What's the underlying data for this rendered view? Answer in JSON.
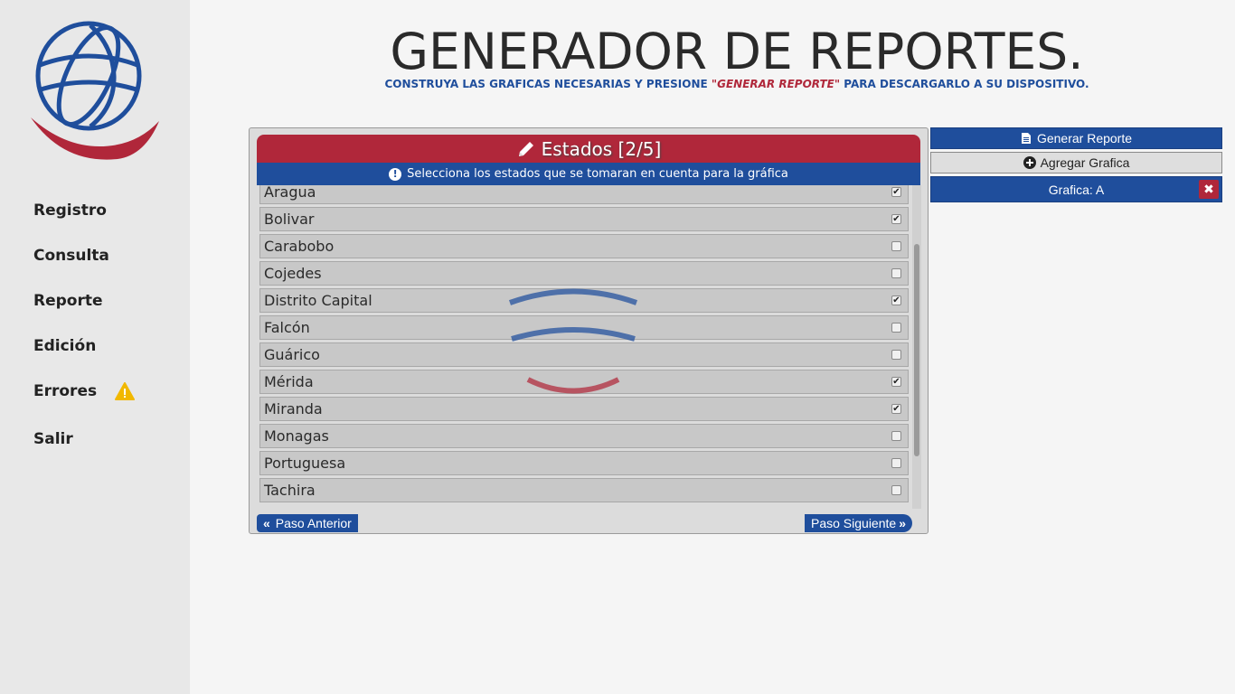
{
  "sidebar": {
    "nav": [
      {
        "label": "Registro"
      },
      {
        "label": "Consulta"
      },
      {
        "label": "Reporte"
      },
      {
        "label": "Edición"
      },
      {
        "label": "Errores"
      },
      {
        "label": "Salir"
      }
    ]
  },
  "header": {
    "title": "GENERADOR DE REPORTES.",
    "subtitle_pre": "CONSTRUYA LAS GRAFICAS NECESARIAS Y PRESIONE ",
    "subtitle_em": "\"GENERAR REPORTE\"",
    "subtitle_post": " PARA DESCARGARLO A SU DISPOSITIVO."
  },
  "panel": {
    "title": "Estados [2/5]",
    "info": "Selecciona los estados que se tomaran en cuenta para la gráfica",
    "states": [
      {
        "name": "Aragua",
        "checked": true
      },
      {
        "name": "Bolivar",
        "checked": true
      },
      {
        "name": "Carabobo",
        "checked": false
      },
      {
        "name": "Cojedes",
        "checked": false
      },
      {
        "name": "Distrito Capital",
        "checked": true
      },
      {
        "name": "Falcón",
        "checked": false
      },
      {
        "name": "Guárico",
        "checked": false
      },
      {
        "name": "Mérida",
        "checked": true
      },
      {
        "name": "Miranda",
        "checked": true
      },
      {
        "name": "Monagas",
        "checked": false
      },
      {
        "name": "Portuguesa",
        "checked": false
      },
      {
        "name": "Tachira",
        "checked": false
      }
    ],
    "prev_label": "Paso Anterior",
    "next_label": "Paso Siguiente"
  },
  "right": {
    "generar_label": "Generar Reporte",
    "agregar_label": "Agregar Grafica",
    "grafica_label": "Grafica: A"
  },
  "colors": {
    "primary_blue": "#1f4e9c",
    "primary_red": "#b0273a"
  }
}
